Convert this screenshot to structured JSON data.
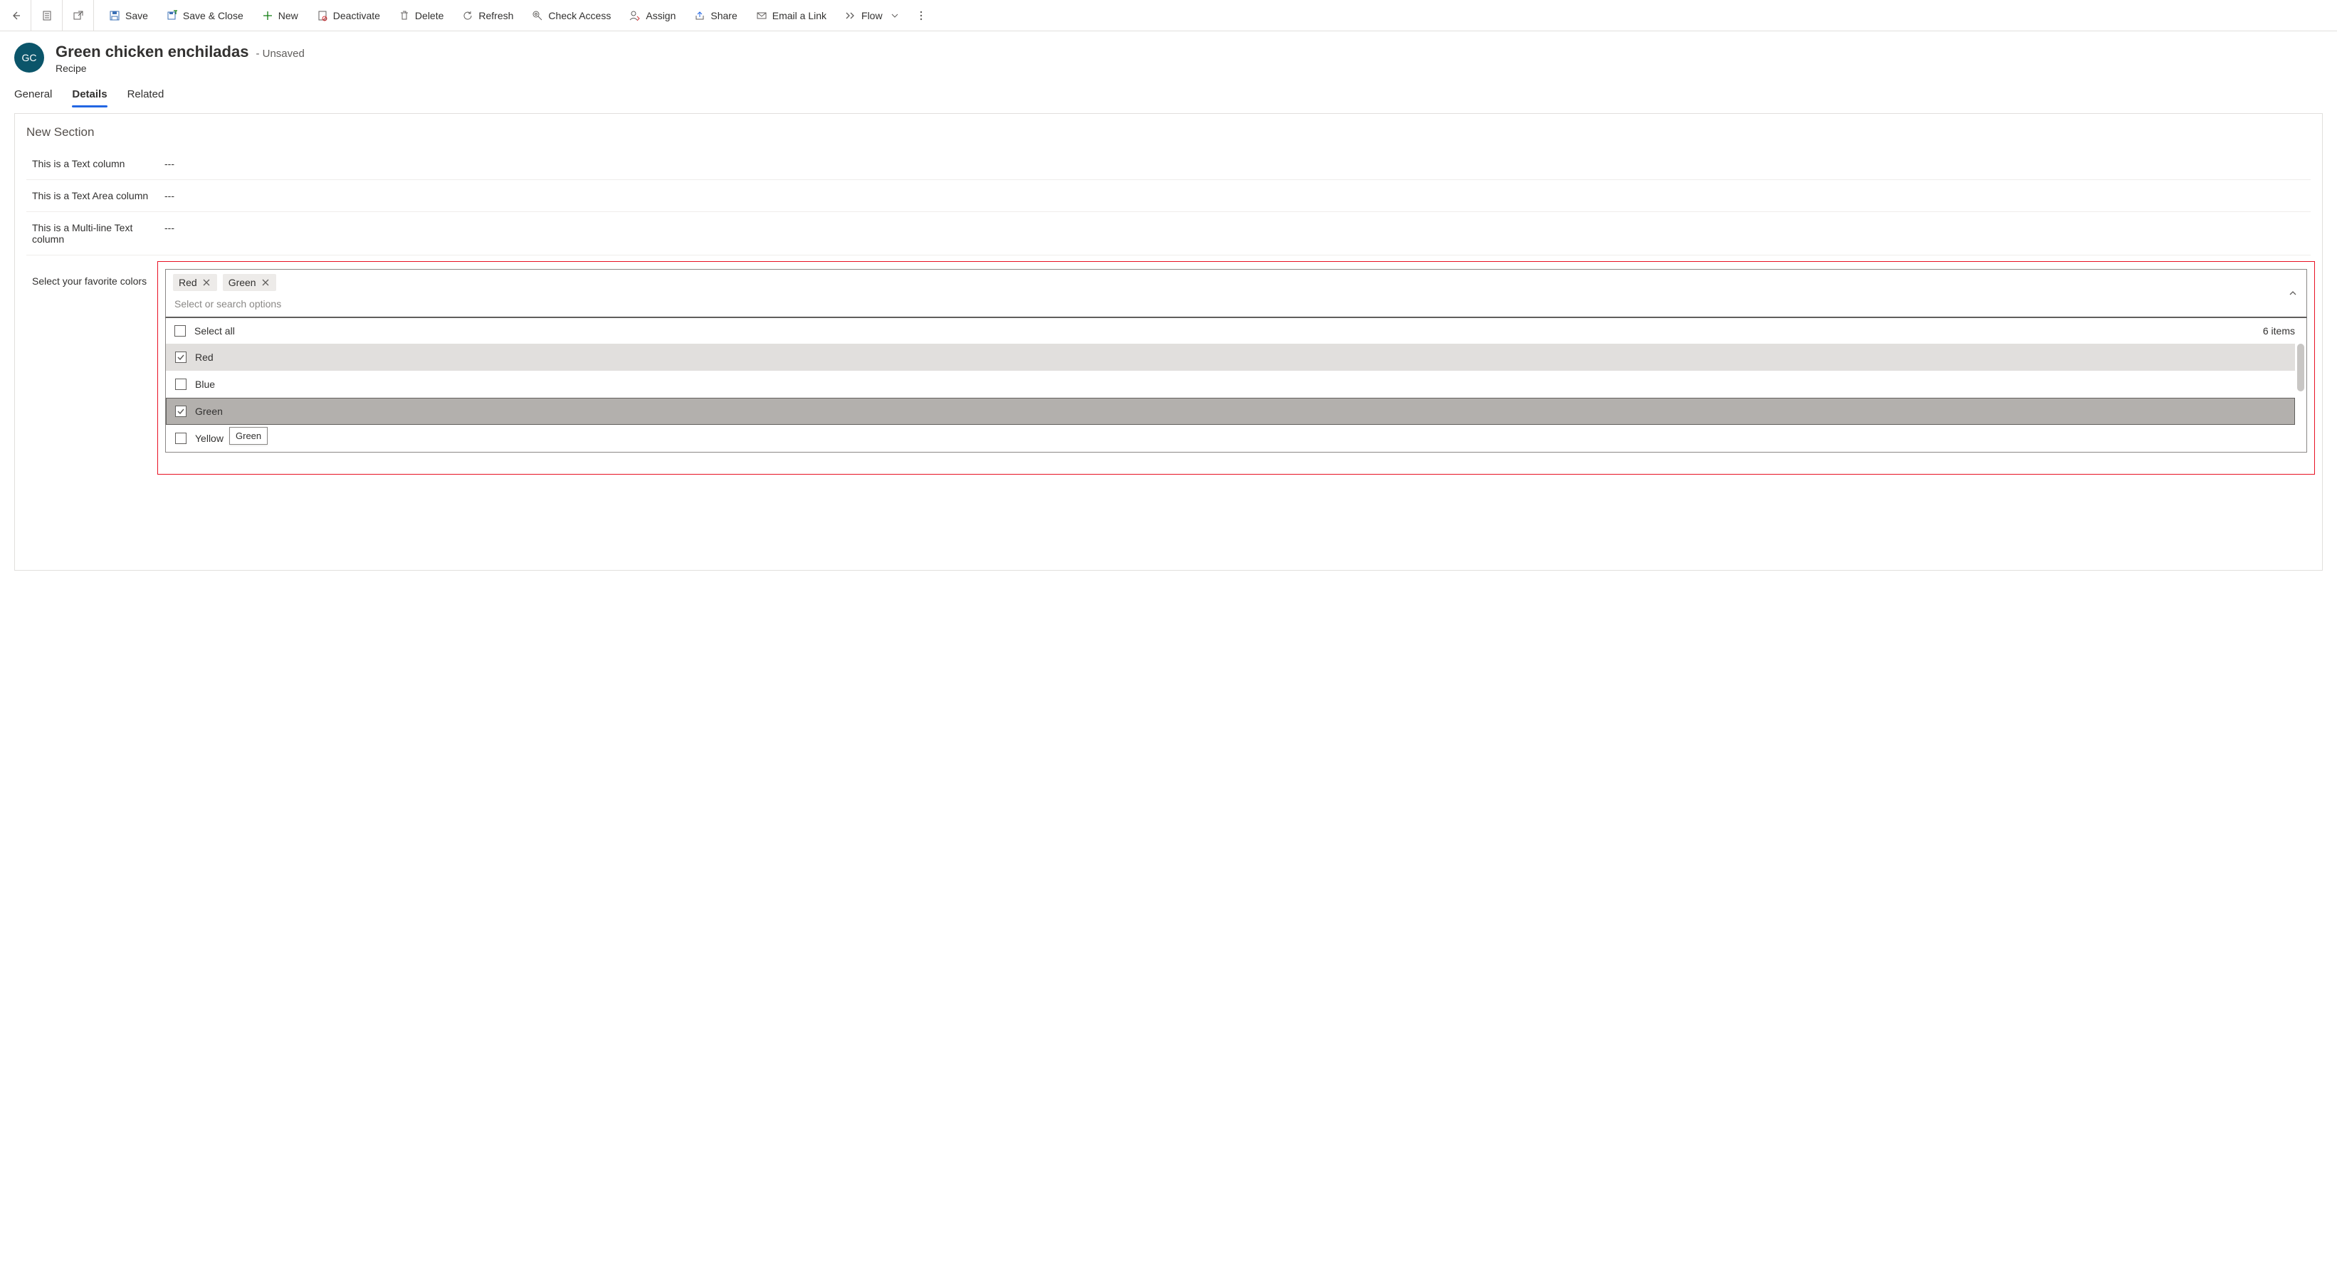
{
  "commands": {
    "save": "Save",
    "saveClose": "Save & Close",
    "new": "New",
    "deactivate": "Deactivate",
    "delete": "Delete",
    "refresh": "Refresh",
    "checkAccess": "Check Access",
    "assign": "Assign",
    "share": "Share",
    "emailLink": "Email a Link",
    "flow": "Flow"
  },
  "header": {
    "avatar": "GC",
    "title": "Green chicken enchiladas",
    "unsaved": "- Unsaved",
    "entity": "Recipe"
  },
  "tabs": {
    "general": "General",
    "details": "Details",
    "related": "Related"
  },
  "section": {
    "title": "New Section",
    "field1_label": "This is a Text column",
    "field1_value": "---",
    "field2_label": "This is a Text Area column",
    "field2_value": "---",
    "field3_label": "This is a Multi-line Text column",
    "field3_value": "---",
    "field4_label": "Select your favorite colors"
  },
  "picker": {
    "chips": {
      "c1": "Red",
      "c2": "Green"
    },
    "placeholder": "Select or search options",
    "selectAll": "Select all",
    "countText": "6 items",
    "options": {
      "o1": "Red",
      "o2": "Blue",
      "o3": "Green",
      "o4": "Yellow"
    },
    "tooltip": "Green"
  }
}
